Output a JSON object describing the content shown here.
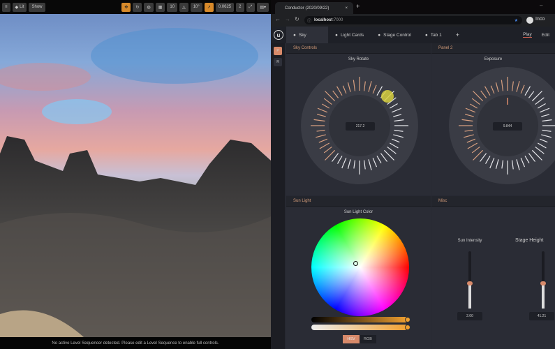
{
  "viewport": {
    "toolbar": {
      "lit_label": "Lit",
      "show_label": "Show",
      "grid_snap": "10",
      "angle_snap": "10°",
      "scale_snap": "0.0625",
      "camera_speed": "2"
    },
    "status_message": "No active Level Sequencer detected. Please edit a Level Sequence to enable full controls."
  },
  "browser": {
    "tab_title": "Conductor (2020/09/22)",
    "tab_close": "×",
    "new_tab": "+",
    "url_host": "localhost",
    "url_port": ":7000",
    "profile_label": "Inco"
  },
  "app": {
    "tabs": [
      {
        "label": "Sky"
      },
      {
        "label": "Light Cards"
      },
      {
        "label": "Stage Control"
      },
      {
        "label": "Tab 1"
      }
    ],
    "add_tab": "+",
    "play_label": "Play",
    "edit_label": "Edit",
    "sidebar": [
      "P",
      "R"
    ],
    "panels": {
      "sky_controls": {
        "title": "Sky Controls",
        "dial_label": "Sky Rotate",
        "value": "217.2"
      },
      "panel2": {
        "title": "Panel 2",
        "dial_label": "Exposure",
        "value": "9.844"
      },
      "sun_light": {
        "title": "Sun Light",
        "color_label": "Sun Light Color",
        "mode_hsv": "HSV",
        "mode_rgb": "RGB"
      },
      "misc": {
        "title": "Misc",
        "sliders": [
          {
            "label": "Sun Intensity",
            "value": "2.00",
            "level": 0.45
          },
          {
            "label": "Stage Height",
            "value": "41.21",
            "level": 0.45
          }
        ]
      }
    }
  },
  "colors": {
    "accent": "#d88a6a",
    "dial_tick": "#d8a080",
    "selected_color": "#f0a030"
  }
}
